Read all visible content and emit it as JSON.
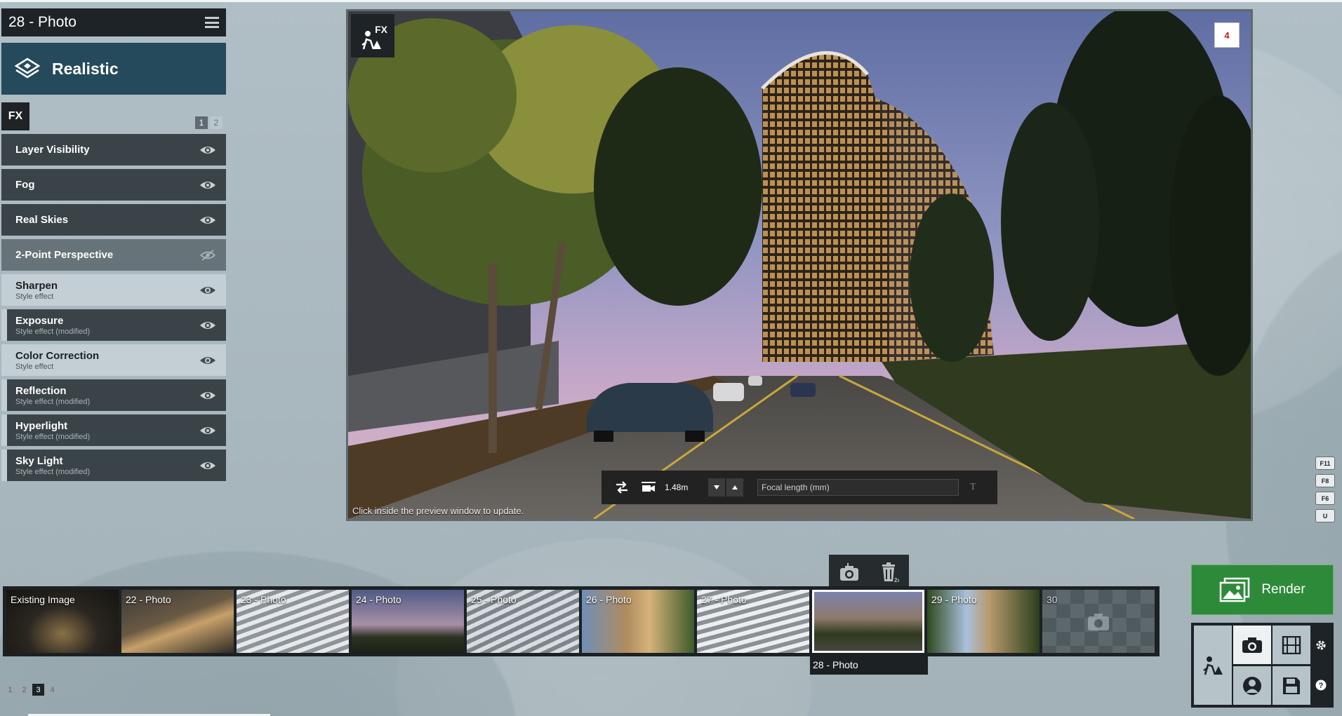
{
  "scene": {
    "title": "28 - Photo"
  },
  "style": {
    "label": "Realistic"
  },
  "fx_panel": {
    "tab_label": "FX",
    "pages": [
      "1",
      "2"
    ],
    "active_page": "1",
    "effects": [
      {
        "name": "Layer Visibility",
        "subtitle": "",
        "visible": true,
        "tone": "dark"
      },
      {
        "name": "Fog",
        "subtitle": "",
        "visible": true,
        "tone": "dark"
      },
      {
        "name": "Real Skies",
        "subtitle": "",
        "visible": true,
        "tone": "dark"
      },
      {
        "name": "2-Point Perspective",
        "subtitle": "",
        "visible": false,
        "tone": "mid"
      },
      {
        "name": "Sharpen",
        "subtitle": "Style effect",
        "visible": true,
        "tone": "light"
      },
      {
        "name": "Exposure",
        "subtitle": "Style effect (modified)",
        "visible": true,
        "tone": "dark"
      },
      {
        "name": "Color Correction",
        "subtitle": "Style effect",
        "visible": true,
        "tone": "light"
      },
      {
        "name": "Reflection",
        "subtitle": "Style effect (modified)",
        "visible": true,
        "tone": "dark"
      },
      {
        "name": "Hyperlight",
        "subtitle": "Style effect (modified)",
        "visible": true,
        "tone": "dark"
      },
      {
        "name": "Sky Light",
        "subtitle": "Style effect (modified)",
        "visible": true,
        "tone": "dark"
      }
    ]
  },
  "preview": {
    "fx_badge": "FX",
    "count_badge": "4",
    "hint": "Click inside the preview window to update."
  },
  "camera_toolbar": {
    "height_value": "1.48m",
    "focal_placeholder": "Focal length (mm)",
    "text_icon": "T"
  },
  "function_keys": [
    "F11",
    "F8",
    "F6",
    "U"
  ],
  "filmstrip": {
    "items": [
      {
        "label": "Existing Image",
        "theme": "night-aerial"
      },
      {
        "label": "22 - Photo",
        "theme": "dusk-aerial"
      },
      {
        "label": "23 - Photo",
        "theme": "facade-day"
      },
      {
        "label": "24 - Photo",
        "theme": "dusk-street"
      },
      {
        "label": "25 - Photo",
        "theme": "facade-day"
      },
      {
        "label": "26 - Photo",
        "theme": "tower-day"
      },
      {
        "label": "27 - Photo",
        "theme": "facade-day"
      },
      {
        "label": "28 - Photo",
        "theme": "current",
        "selected": true
      },
      {
        "label": "29 - Photo",
        "theme": "tower-trees"
      },
      {
        "label": "30",
        "theme": "empty"
      }
    ],
    "selected_caption": "28 - Photo"
  },
  "pager": {
    "pages": [
      "1",
      "2",
      "3",
      "4"
    ],
    "active_page": "3"
  },
  "render": {
    "label": "Render"
  },
  "colors": {
    "accent_blue": "#244a5b",
    "render_green": "#2d8a39",
    "panel_dark": "#3a4348",
    "badge_red": "#d01616"
  },
  "icons": {
    "menu": "menu-icon",
    "style": "realistic-style-icon",
    "visibility_on": "eye-icon",
    "visibility_off": "eye-off-icon",
    "effects": "worker-fx-icon",
    "snapshot": "camera-icon",
    "delete": "trash-icon",
    "render": "image-render-icon",
    "settings": "gear-icon",
    "help": "help-icon"
  }
}
